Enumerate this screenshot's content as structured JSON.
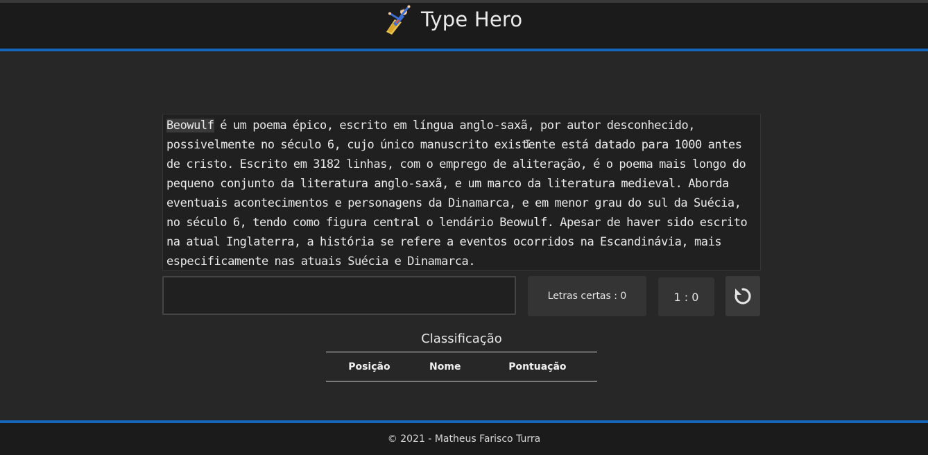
{
  "header": {
    "title": "Type Hero",
    "logo_icon": "superhero-icon"
  },
  "text_panel": {
    "current_word": "Beowulf",
    "remaining_text": " é um poema épico, escrito em língua anglo-saxã, por autor desconhecido, possivelmente no século 6, cujo único manuscrito existente está datado para 1000 antes de cristo. Escrito em 3182 linhas, com o emprego de aliteração, é o poema mais longo do pequeno conjunto da literatura anglo-saxã, e um marco da literatura medieval. Aborda eventuais acontecimentos e personagens da Dinamarca, e em menor grau do sul da Suécia, no século 6, tendo como figura central o lendário Beowulf. Apesar de haver sido escrito na atual Inglaterra, a história se refere a eventos ocorridos na Escandinávia, mais especificamente nas atuais Suécia e Dinamarca."
  },
  "typing": {
    "input_value": "",
    "letters_label": "Letras certas : 0",
    "timer": "1 : 0",
    "restart_icon": "restart-icon"
  },
  "ranking": {
    "title": "Classificação",
    "columns": [
      "Posição",
      "Nome",
      "Pontuação"
    ],
    "rows": []
  },
  "footer": {
    "copyright": "© 2021 - Matheus Farisco Turra"
  },
  "colors": {
    "accent": "#1565b8",
    "background": "#272727",
    "bar": "#1b1b1b"
  }
}
